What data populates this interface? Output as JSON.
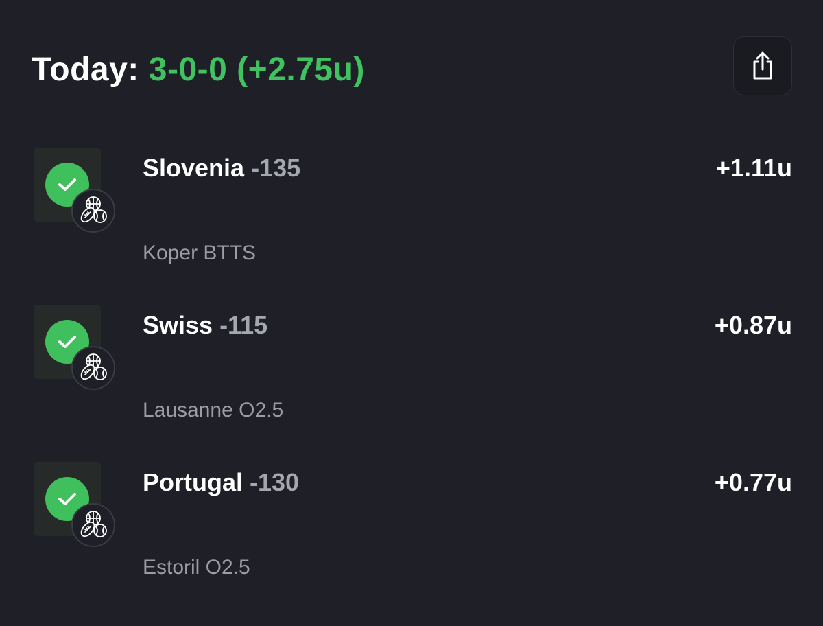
{
  "header": {
    "label": "Today:",
    "record": "3-0-0 (+2.75u)",
    "accent_color": "#3fc25f"
  },
  "share": {
    "icon": "share-icon"
  },
  "bets": [
    {
      "team": "Slovenia",
      "odds": "-135",
      "units": "+1.11u",
      "detail": "Koper BTTS",
      "status": "won",
      "status_icon": "check-icon",
      "sport_icon": "multi-sport-icon"
    },
    {
      "team": "Swiss",
      "odds": "-115",
      "units": "+0.87u",
      "detail": "Lausanne O2.5",
      "status": "won",
      "status_icon": "check-icon",
      "sport_icon": "multi-sport-icon"
    },
    {
      "team": "Portugal",
      "odds": "-130",
      "units": "+0.77u",
      "detail": "Estoril O2.5",
      "status": "won",
      "status_icon": "check-icon",
      "sport_icon": "multi-sport-icon"
    }
  ]
}
